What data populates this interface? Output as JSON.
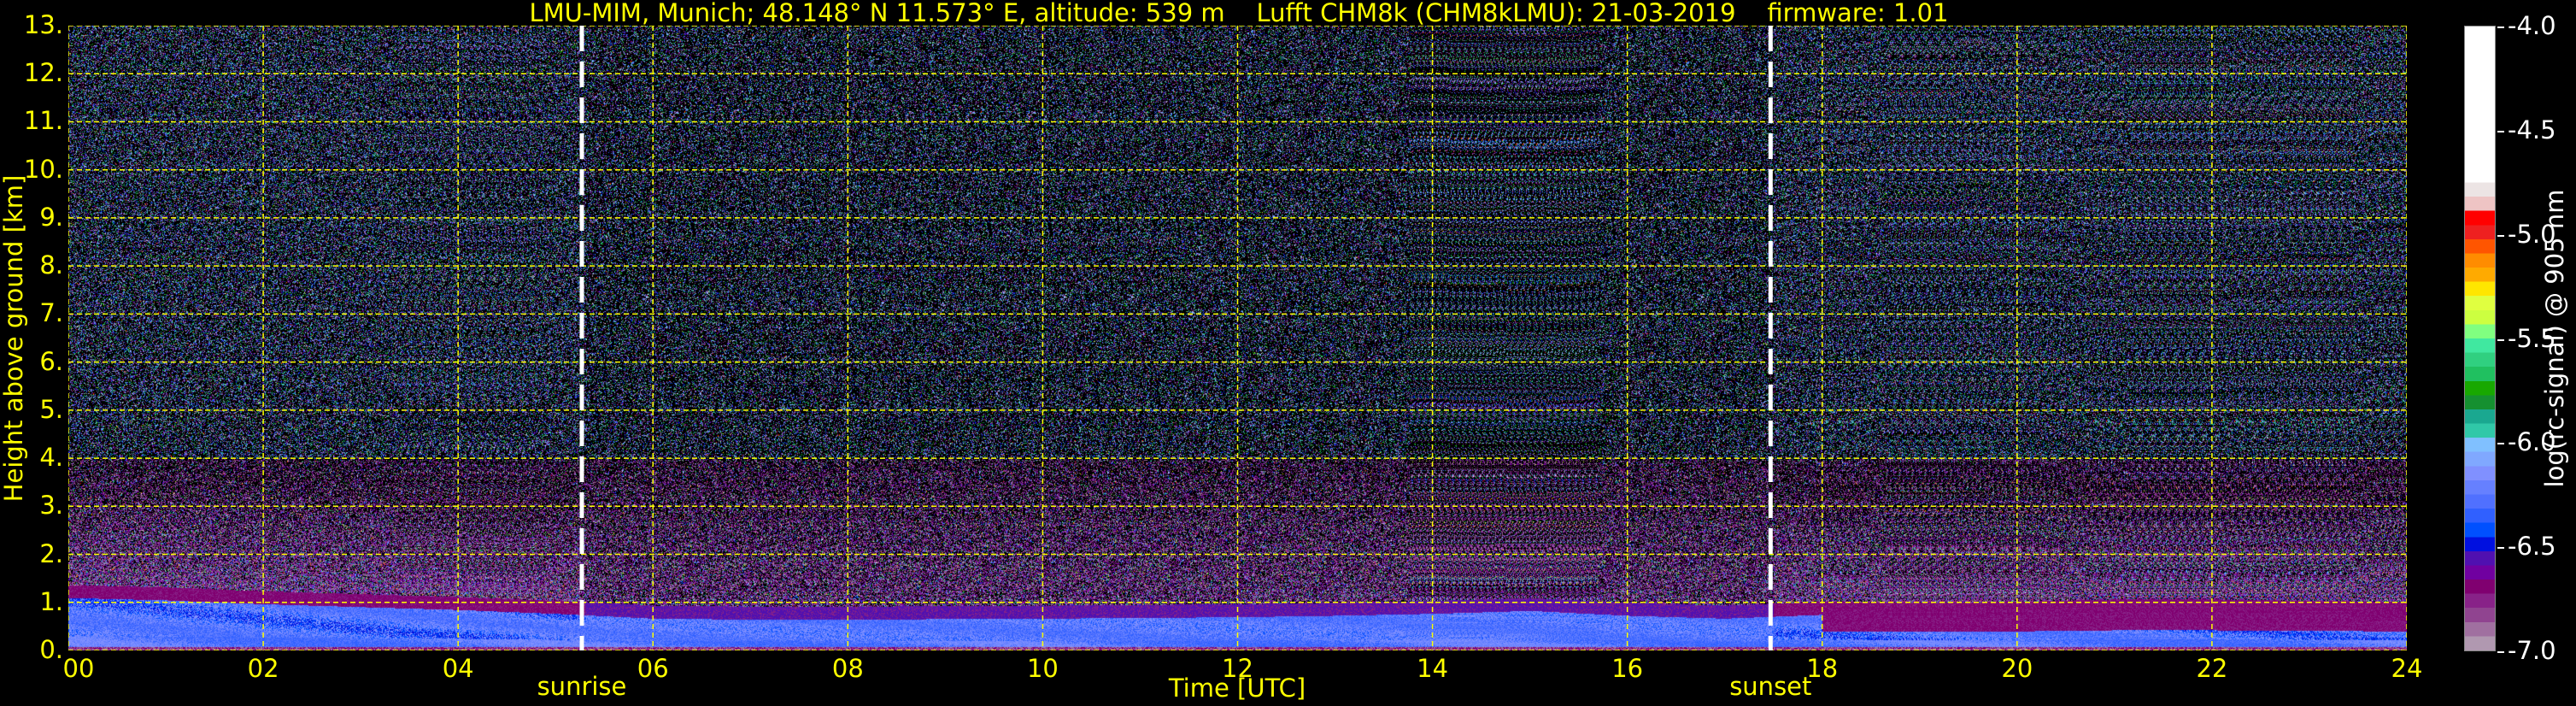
{
  "chart_data": {
    "type": "heatmap",
    "title": "LMU-MIM, Munich; 48.148° N 11.573° E, altitude: 539 m    Lufft CHM8k (CHM8kLMU): 21-03-2019    firmware: 1.01",
    "xlabel": "Time [UTC]",
    "ylabel": "Height above ground [km]",
    "xlim": [
      0,
      24
    ],
    "ylim": [
      0,
      13
    ],
    "grid": true,
    "x_ticks": [
      0,
      2,
      4,
      6,
      8,
      10,
      12,
      14,
      16,
      18,
      20,
      22,
      24
    ],
    "x_tick_labels": [
      "00",
      "02",
      "04",
      "06",
      "08",
      "10",
      "12",
      "14",
      "16",
      "18",
      "20",
      "22",
      "24"
    ],
    "y_ticks": [
      0,
      1,
      2,
      3,
      4,
      5,
      6,
      7,
      8,
      9,
      10,
      11,
      12,
      13
    ],
    "y_tick_labels": [
      "0.",
      "1.",
      "2.",
      "3.",
      "4.",
      "5.",
      "6.",
      "7.",
      "8.",
      "9.",
      "10.",
      "11.",
      "12.",
      "13."
    ],
    "events": [
      {
        "label": "sunrise",
        "time_h": 5.27
      },
      {
        "label": "sunset",
        "time_h": 17.47
      }
    ],
    "aerosol_layer_top_km": {
      "time_h": [
        0,
        1,
        2,
        3,
        4,
        5,
        6,
        7,
        8,
        10,
        12,
        13,
        14,
        15,
        16,
        17,
        18,
        19,
        20,
        21,
        22,
        23,
        24
      ],
      "height_km": [
        1.25,
        1.2,
        1.12,
        1.06,
        1.0,
        0.92,
        0.82,
        0.8,
        0.8,
        0.82,
        0.85,
        0.88,
        0.92,
        0.98,
        0.88,
        0.82,
        0.9,
        0.88,
        0.9,
        0.95,
        0.95,
        0.92,
        0.9
      ]
    },
    "colorbar": {
      "label": "log(rc-signal) @ 905 nm",
      "range": [
        -7.0,
        -4.0
      ],
      "ticks": [
        -4.0,
        -4.5,
        -5.0,
        -5.5,
        -6.0,
        -6.5,
        -7.0
      ],
      "tick_labels": [
        "-4.0",
        "-4.5",
        "-5.0",
        "-5.5",
        "-6.0",
        "-6.5",
        "-7.0"
      ],
      "colors_top_to_bottom": [
        "#ffffff",
        "#ece4e4",
        "#eec4c4",
        "#ff0000",
        "#ee2020",
        "#ff5500",
        "#ff8c00",
        "#ffaa00",
        "#ffe600",
        "#e0ff40",
        "#ccff40",
        "#80ff80",
        "#40e8a0",
        "#30d080",
        "#20c060",
        "#18a800",
        "#159030",
        "#1aa890",
        "#30c8a8",
        "#80c0ff",
        "#80a8ff",
        "#8090ff",
        "#6680ff",
        "#5070ff",
        "#3060ff",
        "#0050ff",
        "#0010e0",
        "#5010b0",
        "#7000a0",
        "#800070",
        "#882288",
        "#904490",
        "#a070a0",
        "#b098b0"
      ]
    }
  }
}
